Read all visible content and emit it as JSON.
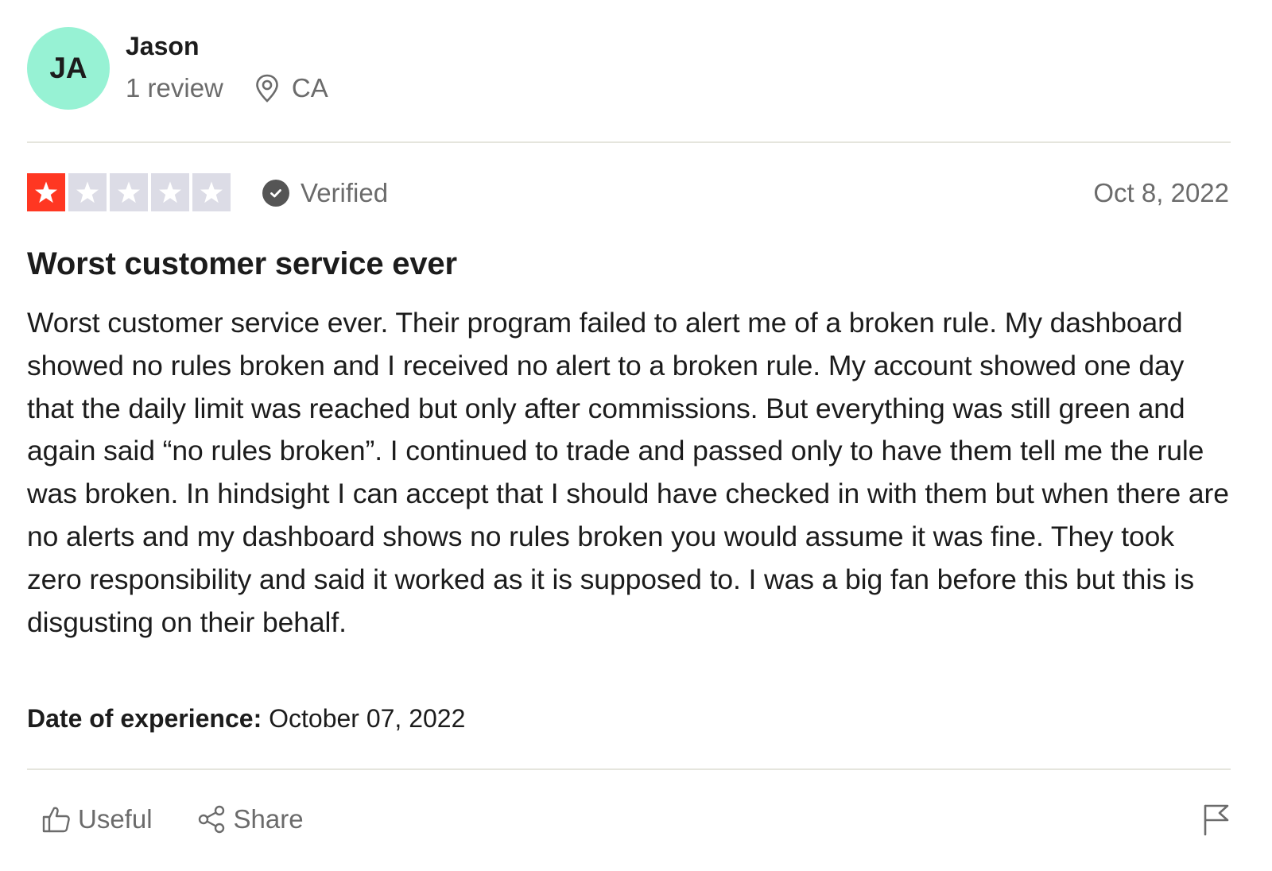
{
  "reviewer": {
    "initials": "JA",
    "avatar_color": "#97f2d4",
    "name": "Jason",
    "review_count": "1 review",
    "location_icon": "location-pin-icon",
    "country": "CA"
  },
  "review": {
    "rating": 1,
    "rating_max": 5,
    "star_color_filled": "#ff3722",
    "star_color_empty": "#dcdce6",
    "verified_icon": "check-circle-icon",
    "verified_label": "Verified",
    "date": "Oct 8, 2022",
    "title": "Worst customer service ever",
    "body": "Worst customer service ever. Their program failed to alert me of a broken rule. My dashboard showed no rules broken and I received no alert to a broken rule. My account showed one day that the daily limit was reached but only after commissions. But everything was still green and again said “no rules broken”. I continued to trade and passed only to have them tell me the rule was broken. In hindsight I can accept that I should have checked in with them but when there are no alerts and my dashboard shows no rules broken you would assume it was fine. They took zero responsibility and said it worked as it is supposed to. I was a big fan before this but this is disgusting on their behalf.",
    "experience_label": "Date of experience:",
    "experience_date": "October 07, 2022"
  },
  "actions": {
    "useful_icon": "thumbs-up-icon",
    "useful_label": "Useful",
    "share_icon": "share-icon",
    "share_label": "Share",
    "report_icon": "flag-icon"
  }
}
